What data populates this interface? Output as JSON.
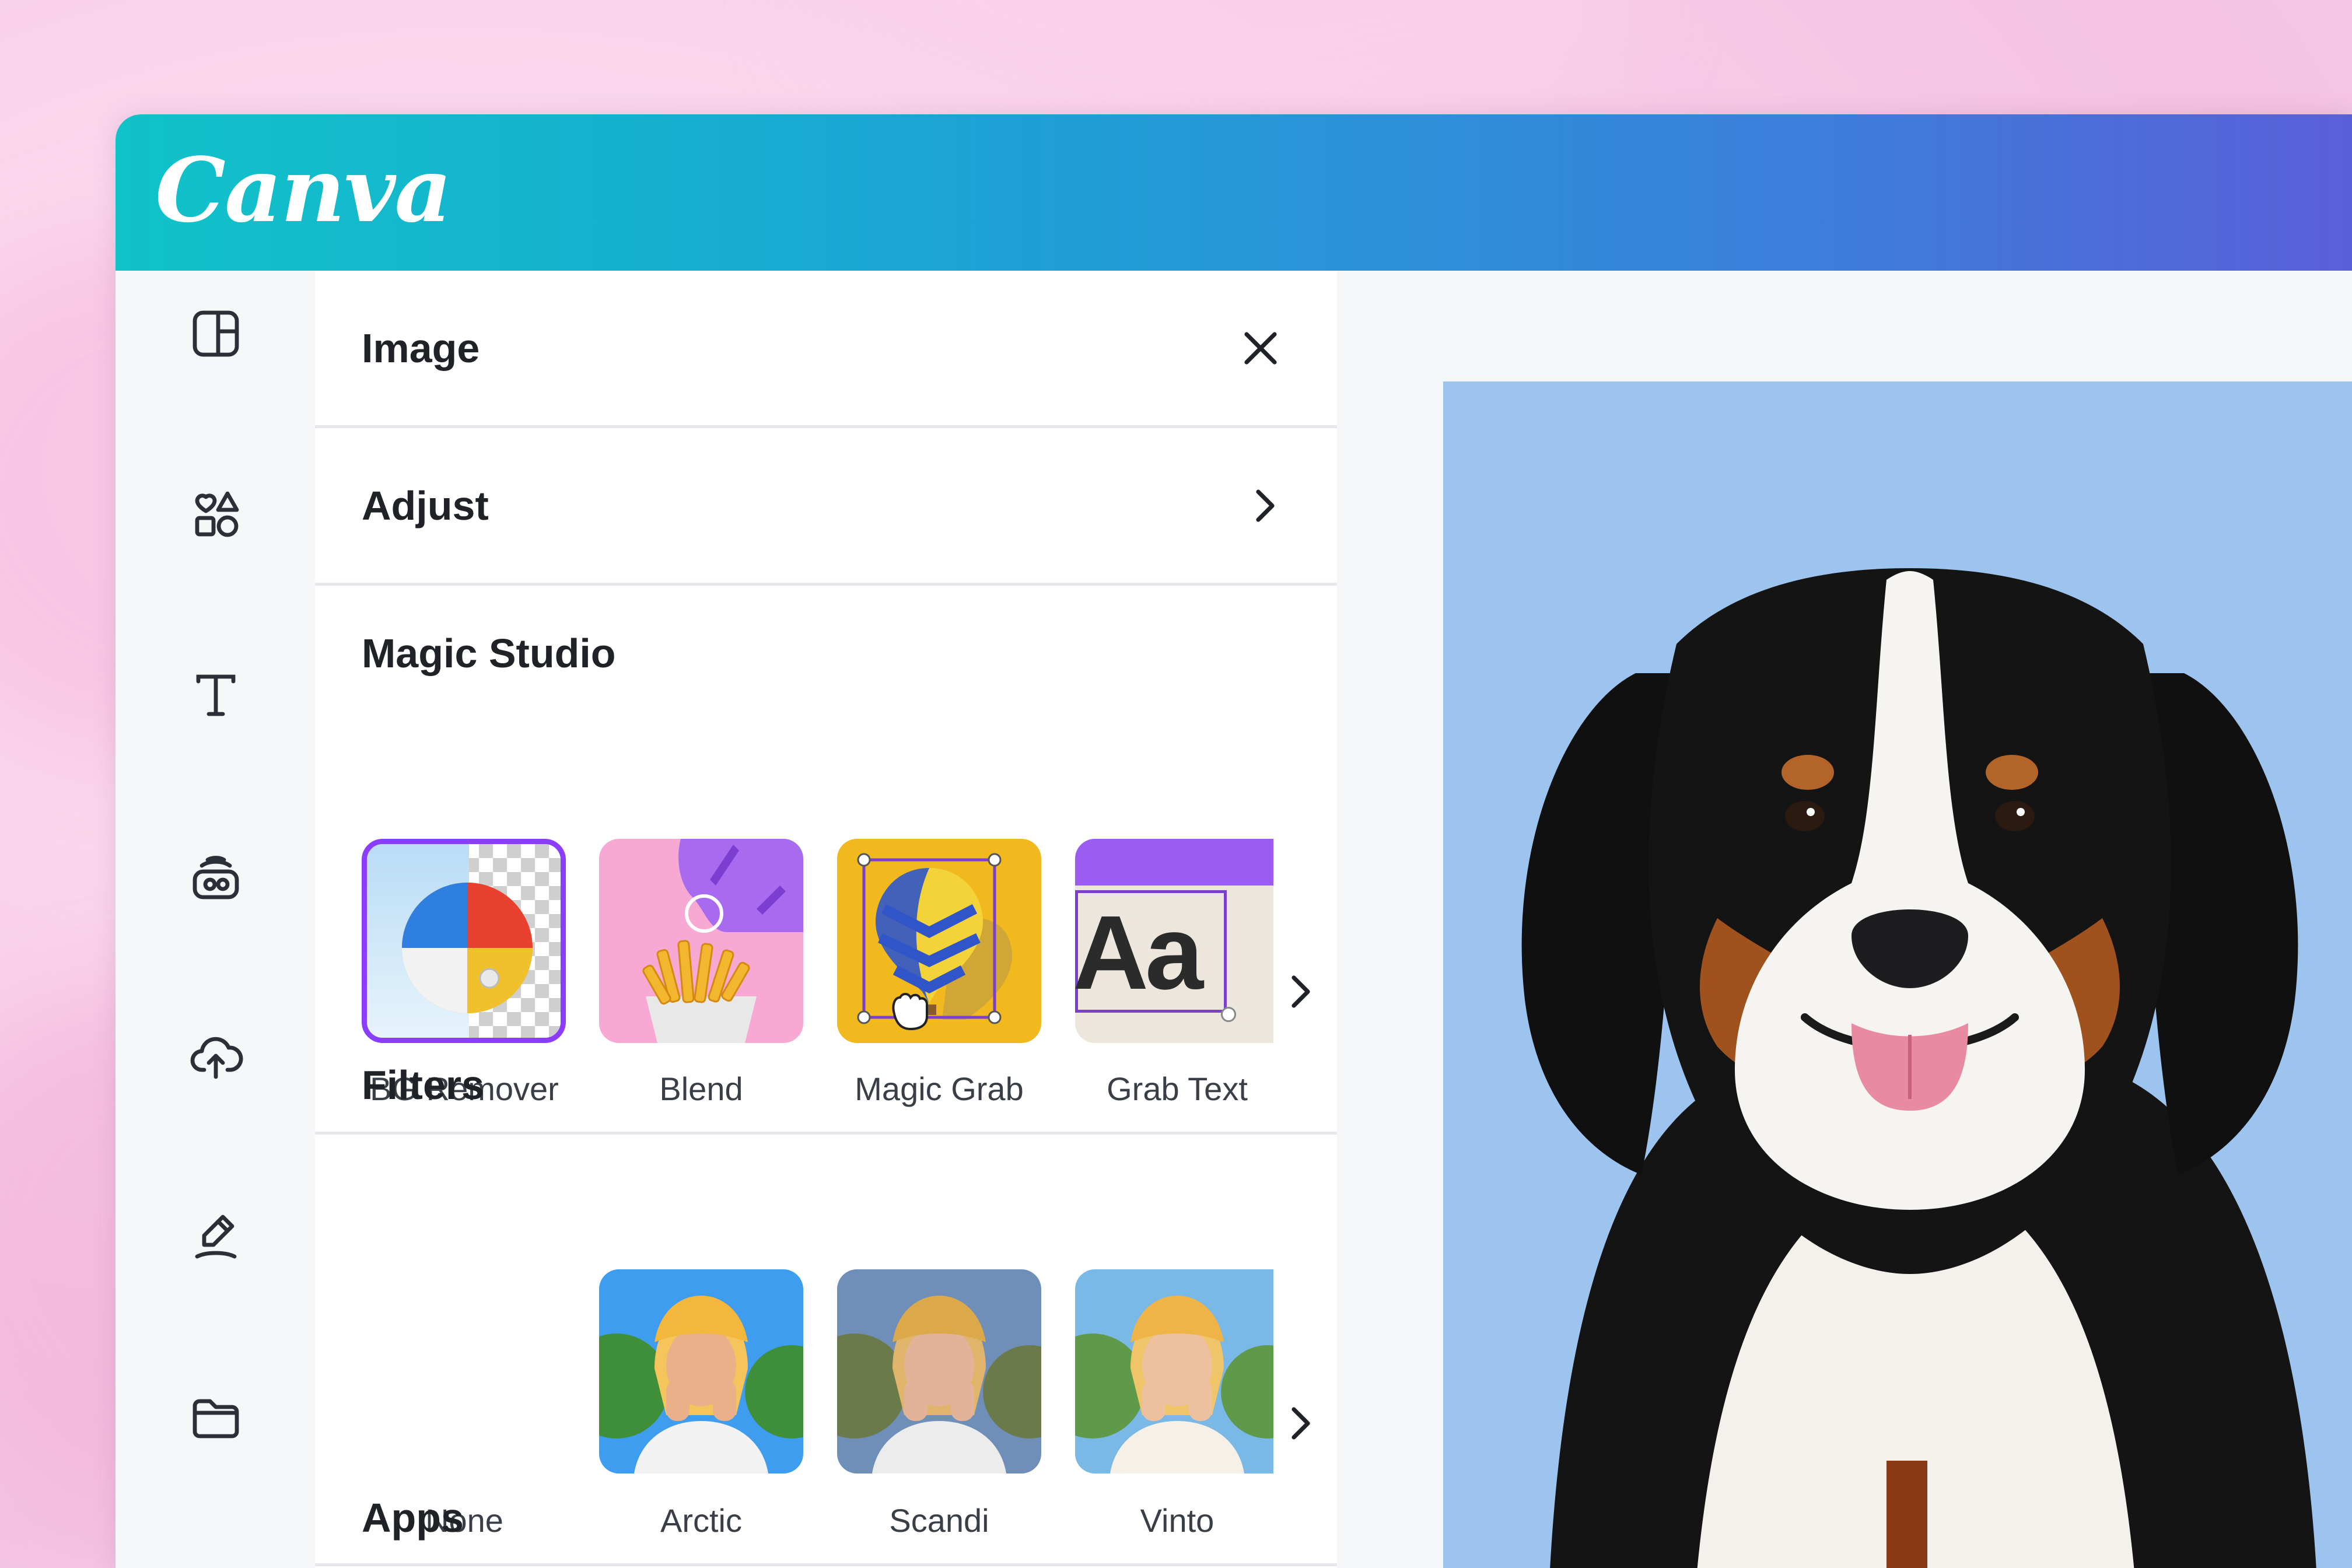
{
  "app": {
    "logo_text": "Canva"
  },
  "rail": {
    "items": [
      {
        "icon": "layout-icon"
      },
      {
        "icon": "elements-icon"
      },
      {
        "icon": "text-icon"
      },
      {
        "icon": "brand-icon"
      },
      {
        "icon": "upload-cloud-icon"
      },
      {
        "icon": "draw-icon"
      },
      {
        "icon": "folder-icon"
      }
    ]
  },
  "panel": {
    "title": "Image",
    "adjust_label": "Adjust",
    "magic_studio": {
      "title": "Magic Studio",
      "tools": [
        {
          "label": "BG Remover"
        },
        {
          "label": "Blend"
        },
        {
          "label": "Magic Grab"
        },
        {
          "label": "Grab Text"
        }
      ]
    },
    "filters": {
      "title": "Filters",
      "items": [
        {
          "label": "None"
        },
        {
          "label": "Arctic"
        },
        {
          "label": "Scandi"
        },
        {
          "label": "Vinto"
        }
      ]
    },
    "apps_title": "Apps",
    "grab_text_sample": "Aa"
  },
  "colors": {
    "header_start": "#10c3c8",
    "header_end": "#5a5fd8",
    "accent_purple": "#8b3dff",
    "photo_bg": "#9cc4ee"
  }
}
